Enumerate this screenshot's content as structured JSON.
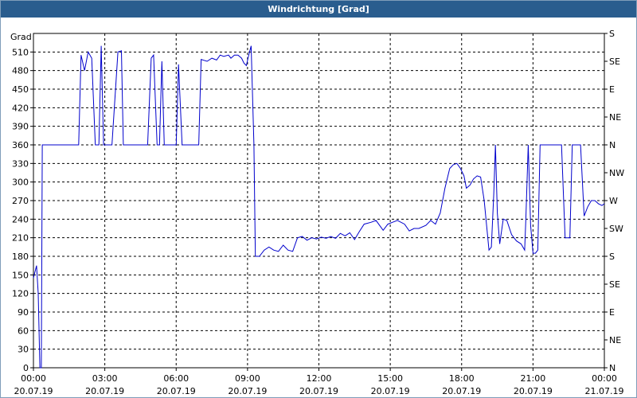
{
  "window": {
    "title": "Windrichtung [Grad]"
  },
  "chart_data": {
    "type": "line",
    "title": "Windrichtung [Grad]",
    "ylabel": "Grad",
    "ylim": [
      0,
      540
    ],
    "yticks": [
      0,
      30,
      60,
      90,
      120,
      150,
      180,
      210,
      240,
      270,
      300,
      330,
      360,
      390,
      420,
      450,
      480,
      510
    ],
    "right_axis": {
      "ticks": [
        {
          "value": 0,
          "label": "N"
        },
        {
          "value": 45,
          "label": "NE"
        },
        {
          "value": 90,
          "label": "E"
        },
        {
          "value": 135,
          "label": "SE"
        },
        {
          "value": 180,
          "label": "S"
        },
        {
          "value": 225,
          "label": "SW"
        },
        {
          "value": 270,
          "label": "W"
        },
        {
          "value": 315,
          "label": "NW"
        },
        {
          "value": 360,
          "label": "N"
        },
        {
          "value": 405,
          "label": "NE"
        },
        {
          "value": 450,
          "label": "E"
        },
        {
          "value": 495,
          "label": "SE"
        },
        {
          "value": 540,
          "label": "S"
        }
      ]
    },
    "xlim": [
      0,
      24
    ],
    "xticks": [
      {
        "value": 0,
        "time": "00:00",
        "date": "20.07.19"
      },
      {
        "value": 3,
        "time": "03:00",
        "date": "20.07.19"
      },
      {
        "value": 6,
        "time": "06:00",
        "date": "20.07.19"
      },
      {
        "value": 9,
        "time": "09:00",
        "date": "20.07.19"
      },
      {
        "value": 12,
        "time": "12:00",
        "date": "20.07.19"
      },
      {
        "value": 15,
        "time": "15:00",
        "date": "20.07.19"
      },
      {
        "value": 18,
        "time": "18:00",
        "date": "20.07.19"
      },
      {
        "value": 21,
        "time": "21:00",
        "date": "20.07.19"
      },
      {
        "value": 24,
        "time": "00:00",
        "date": "21.07.19"
      }
    ],
    "grid": true,
    "series": [
      {
        "color": "#0000cc",
        "points": [
          [
            0.0,
            145
          ],
          [
            0.13,
            165
          ],
          [
            0.2,
            120
          ],
          [
            0.27,
            0
          ],
          [
            0.33,
            0
          ],
          [
            0.37,
            360
          ],
          [
            1.9,
            360
          ],
          [
            2.0,
            505
          ],
          [
            2.15,
            480
          ],
          [
            2.3,
            510
          ],
          [
            2.45,
            500
          ],
          [
            2.6,
            360
          ],
          [
            2.75,
            360
          ],
          [
            2.85,
            520
          ],
          [
            2.95,
            360
          ],
          [
            3.3,
            360
          ],
          [
            3.55,
            510
          ],
          [
            3.7,
            512
          ],
          [
            3.78,
            360
          ],
          [
            4.8,
            360
          ],
          [
            4.95,
            500
          ],
          [
            5.05,
            505
          ],
          [
            5.2,
            360
          ],
          [
            5.3,
            360
          ],
          [
            5.4,
            495
          ],
          [
            5.5,
            360
          ],
          [
            6.0,
            360
          ],
          [
            6.1,
            490
          ],
          [
            6.25,
            360
          ],
          [
            6.6,
            360
          ],
          [
            6.95,
            360
          ],
          [
            7.05,
            498
          ],
          [
            7.3,
            495
          ],
          [
            7.5,
            500
          ],
          [
            7.7,
            497
          ],
          [
            7.85,
            505
          ],
          [
            8.0,
            503
          ],
          [
            8.2,
            505
          ],
          [
            8.3,
            500
          ],
          [
            8.45,
            505
          ],
          [
            8.6,
            505
          ],
          [
            8.75,
            500
          ],
          [
            8.85,
            492
          ],
          [
            8.95,
            488
          ],
          [
            9.05,
            505
          ],
          [
            9.15,
            520
          ],
          [
            9.27,
            360
          ],
          [
            9.33,
            180
          ],
          [
            9.5,
            180
          ],
          [
            9.7,
            190
          ],
          [
            9.9,
            195
          ],
          [
            10.1,
            190
          ],
          [
            10.3,
            188
          ],
          [
            10.5,
            198
          ],
          [
            10.7,
            190
          ],
          [
            10.9,
            188
          ],
          [
            11.1,
            210
          ],
          [
            11.3,
            212
          ],
          [
            11.5,
            206
          ],
          [
            11.7,
            210
          ],
          [
            11.9,
            208
          ],
          [
            12.1,
            211
          ],
          [
            12.3,
            209
          ],
          [
            12.5,
            212
          ],
          [
            12.7,
            209
          ],
          [
            12.9,
            217
          ],
          [
            13.1,
            213
          ],
          [
            13.3,
            218
          ],
          [
            13.5,
            207
          ],
          [
            13.7,
            220
          ],
          [
            13.9,
            232
          ],
          [
            14.2,
            235
          ],
          [
            14.4,
            238
          ],
          [
            14.7,
            222
          ],
          [
            14.9,
            232
          ],
          [
            15.1,
            235
          ],
          [
            15.3,
            238
          ],
          [
            15.6,
            232
          ],
          [
            15.8,
            221
          ],
          [
            16.0,
            225
          ],
          [
            16.2,
            225
          ],
          [
            16.5,
            230
          ],
          [
            16.7,
            238
          ],
          [
            16.9,
            232
          ],
          [
            17.1,
            250
          ],
          [
            17.3,
            290
          ],
          [
            17.5,
            322
          ],
          [
            17.65,
            328
          ],
          [
            17.8,
            330
          ],
          [
            17.95,
            322
          ],
          [
            18.1,
            310
          ],
          [
            18.2,
            290
          ],
          [
            18.35,
            295
          ],
          [
            18.5,
            305
          ],
          [
            18.65,
            310
          ],
          [
            18.8,
            308
          ],
          [
            18.95,
            270
          ],
          [
            19.05,
            230
          ],
          [
            19.15,
            190
          ],
          [
            19.25,
            195
          ],
          [
            19.35,
            280
          ],
          [
            19.42,
            360
          ],
          [
            19.5,
            250
          ],
          [
            19.6,
            200
          ],
          [
            19.75,
            240
          ],
          [
            19.9,
            238
          ],
          [
            20.1,
            215
          ],
          [
            20.3,
            205
          ],
          [
            20.5,
            200
          ],
          [
            20.65,
            190
          ],
          [
            20.7,
            240
          ],
          [
            20.8,
            360
          ],
          [
            20.9,
            230
          ],
          [
            21.0,
            185
          ],
          [
            21.1,
            185
          ],
          [
            21.2,
            190
          ],
          [
            21.3,
            360
          ],
          [
            21.5,
            360
          ],
          [
            21.7,
            360
          ],
          [
            22.0,
            360
          ],
          [
            22.2,
            360
          ],
          [
            22.35,
            210
          ],
          [
            22.45,
            210
          ],
          [
            22.55,
            210
          ],
          [
            22.65,
            360
          ],
          [
            23.0,
            360
          ],
          [
            23.15,
            245
          ],
          [
            23.3,
            260
          ],
          [
            23.45,
            270
          ],
          [
            23.6,
            270
          ],
          [
            23.75,
            265
          ],
          [
            23.9,
            262
          ],
          [
            24.0,
            265
          ]
        ]
      }
    ]
  }
}
